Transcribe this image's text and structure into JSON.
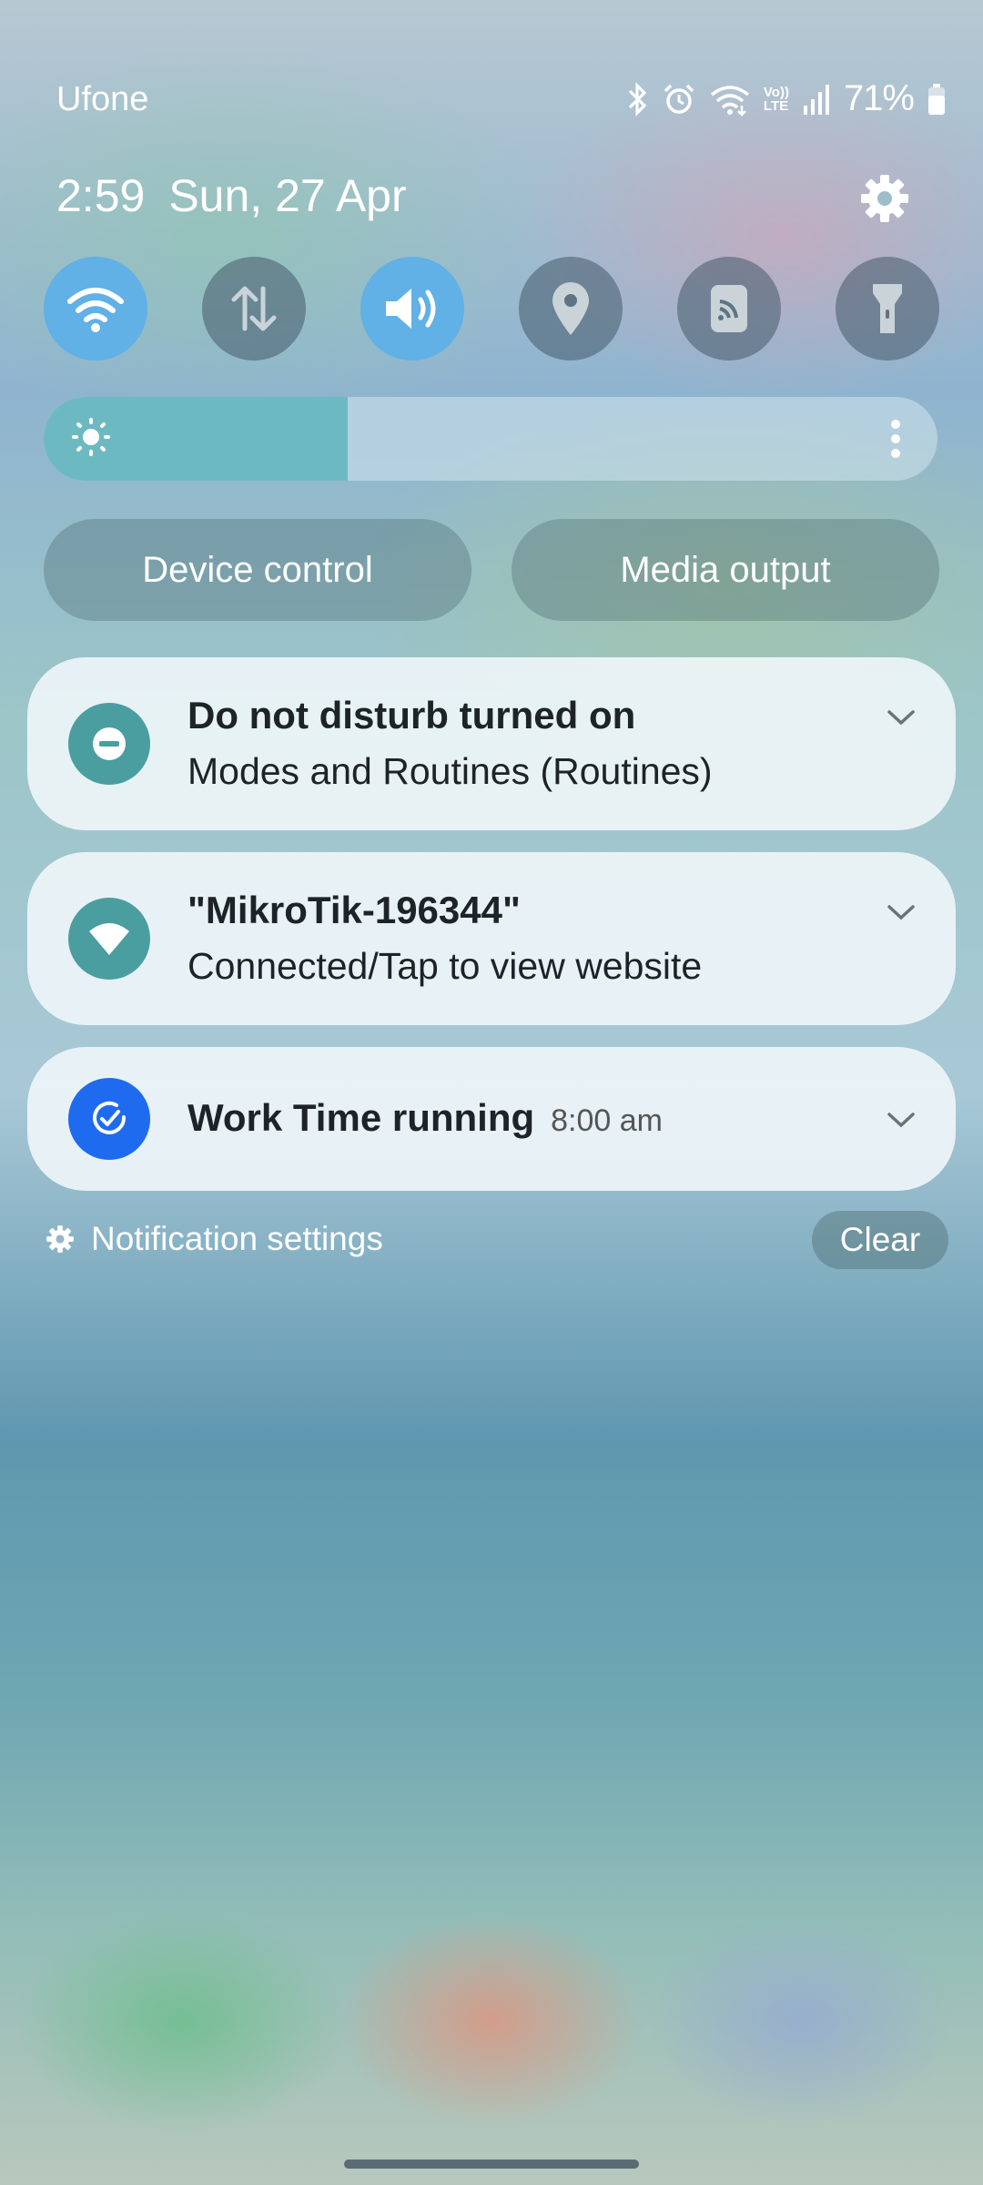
{
  "status_bar": {
    "carrier": "Ufone",
    "battery_percent": "71%",
    "icons": [
      "bluetooth-icon",
      "alarm-icon",
      "wifi-icon",
      "volte-icon",
      "signal-icon",
      "battery-icon"
    ],
    "volte_label_top": "Vo))",
    "volte_label_bottom": "LTE"
  },
  "header": {
    "time": "2:59",
    "date": "Sun, 27 Apr"
  },
  "quick_settings": [
    {
      "name": "wifi",
      "icon": "wifi-icon",
      "active": true
    },
    {
      "name": "mobile-data",
      "icon": "data-arrows-icon",
      "active": false
    },
    {
      "name": "sound",
      "icon": "speaker-icon",
      "active": true
    },
    {
      "name": "location",
      "icon": "location-pin-icon",
      "active": false
    },
    {
      "name": "nfc",
      "icon": "nfc-icon",
      "active": false
    },
    {
      "name": "flashlight",
      "icon": "flashlight-icon",
      "active": false
    }
  ],
  "brightness": {
    "level": 0.34
  },
  "buttons": {
    "device_control": "Device control",
    "media_output": "Media output"
  },
  "notifications": [
    {
      "title": "Do not disturb turned on",
      "subtitle": "Modes and Routines (Routines)",
      "icon": "do-not-disturb-icon",
      "icon_color": "#4a9ea0"
    },
    {
      "title": "\"MikroTik-196344\"",
      "subtitle": "Connected/Tap to view website",
      "icon": "wifi-icon",
      "icon_color": "#4a9ea0"
    },
    {
      "title": "Work Time running",
      "time": "8:00 am",
      "icon": "work-time-icon",
      "icon_color": "#1f6bf0"
    }
  ],
  "footer": {
    "notification_settings": "Notification settings",
    "clear": "Clear"
  }
}
